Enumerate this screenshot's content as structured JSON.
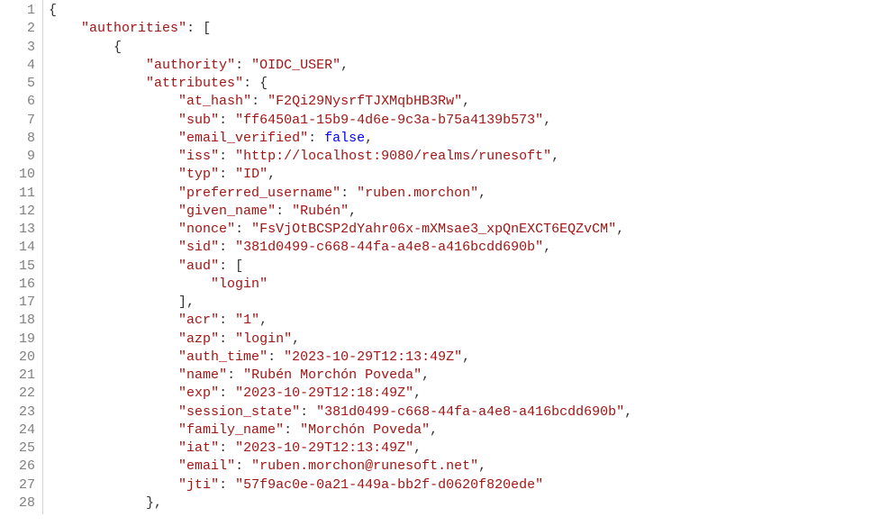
{
  "lineCount": 28,
  "code": {
    "authorities_key": "authorities",
    "authority_key": "authority",
    "authority_val": "OIDC_USER",
    "attributes_key": "attributes",
    "attr": {
      "at_hash_key": "at_hash",
      "at_hash_val": "F2Qi29NysrfTJXMqbHB3Rw",
      "sub_key": "sub",
      "sub_val": "ff6450a1-15b9-4d6e-9c3a-b75a4139b573",
      "email_verified_key": "email_verified",
      "email_verified_val": "false",
      "iss_key": "iss",
      "iss_val": "http://localhost:9080/realms/runesoft",
      "typ_key": "typ",
      "typ_val": "ID",
      "preferred_username_key": "preferred_username",
      "preferred_username_val": "ruben.morchon",
      "given_name_key": "given_name",
      "given_name_val": "Rubén",
      "nonce_key": "nonce",
      "nonce_val": "FsVjOtBCSP2dYahr06x-mXMsae3_xpQnEXCT6EQZvCM",
      "sid_key": "sid",
      "sid_val": "381d0499-c668-44fa-a4e8-a416bcdd690b",
      "aud_key": "aud",
      "aud_item0": "login",
      "acr_key": "acr",
      "acr_val": "1",
      "azp_key": "azp",
      "azp_val": "login",
      "auth_time_key": "auth_time",
      "auth_time_val": "2023-10-29T12:13:49Z",
      "name_key": "name",
      "name_val": "Rubén Morchón Poveda",
      "exp_key": "exp",
      "exp_val": "2023-10-29T12:18:49Z",
      "session_state_key": "session_state",
      "session_state_val": "381d0499-c668-44fa-a4e8-a416bcdd690b",
      "family_name_key": "family_name",
      "family_name_val": "Morchón Poveda",
      "iat_key": "iat",
      "iat_val": "2023-10-29T12:13:49Z",
      "email_key": "email",
      "email_val": "ruben.morchon@runesoft.net",
      "jti_key": "jti",
      "jti_val": "57f9ac0e-0a21-449a-bb2f-d0620f820ede"
    }
  }
}
